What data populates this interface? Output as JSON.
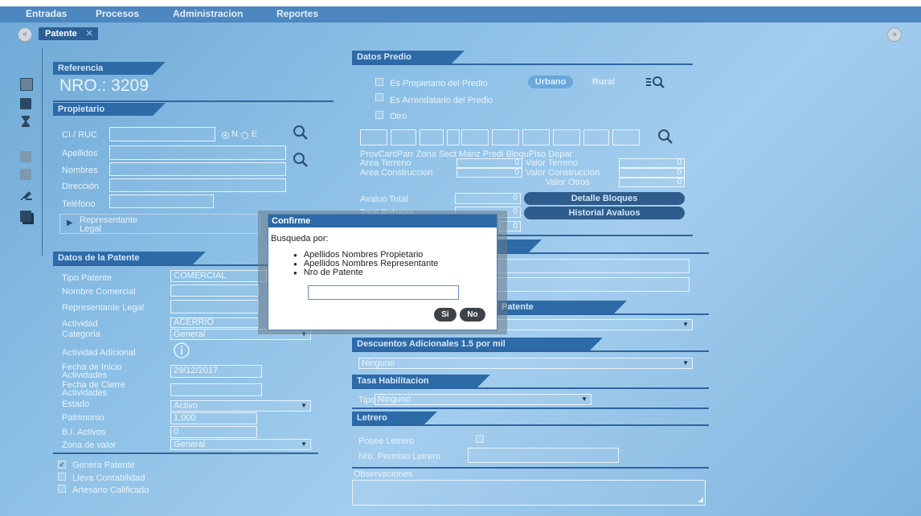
{
  "menu": [
    "Entradas",
    "Procesos",
    "Administracion",
    "Reportes"
  ],
  "tab": {
    "label": "Patente",
    "close": "✕"
  },
  "nav": {
    "prev": "«",
    "next": "»"
  },
  "referencia": {
    "header": "Referencia",
    "nro": "NRO.: 3209"
  },
  "propietario": {
    "header": "Propietario",
    "ci_label": "CI / RUC",
    "ci_value": "",
    "radio_n": "N",
    "radio_e": "E",
    "apellidos_label": "Apellidos",
    "nombres_label": "Nombres",
    "direccion_label": "Dirección",
    "telefono_label": "Teléfono",
    "representante_label_1": "Representante",
    "representante_label_2": "Legal"
  },
  "datos_predio": {
    "header": "Datos Predio",
    "es_propietario": "Es Propietario del Predio",
    "es_arrendatario": "Es Arrendatario del Predio",
    "otro": "Otro",
    "urbano": "Urbano",
    "rural": "Rural",
    "col_labels": "ProvCantParr Zona Sect  Manz Predi BloquPiso  Depar",
    "area_terreno_label": "Area Terreno",
    "area_terreno_value": "0",
    "area_construccion_label": "Area Construccion",
    "area_construccion_value": "0",
    "valor_terreno_label": "Valor Terreno",
    "valor_terreno_value": "0",
    "valor_construccion_label": "Valor Construccion",
    "valor_construccion_value": "0",
    "valor_otros_label": "Valor Otros",
    "valor_otros_value": "0",
    "avaluo_total_label": "Avaluo Total",
    "avaluo_total_value": "0",
    "total_rebajas_label": "Total Rebajas",
    "total_rebajas_value": "0",
    "extra_value": "0",
    "detalle_bloques": "Detalle Bloques",
    "historial_avaluos": "Historial Avaluos"
  },
  "datos_patente": {
    "header": "Datos de la Patente",
    "tipo_label": "Tipo Patente",
    "tipo_value": "COMERCIAL",
    "nombre_comercial_label": "Nombre Comercial",
    "representante_legal_label": "Representante Legal",
    "actividad_label": "Actividad",
    "actividad_value": "ACERRIO",
    "categoria_label": "Categoria",
    "categoria_value": "General",
    "actividad_adicional_label": "Actividad Adicional",
    "fecha_inicio_label_1": "Fecha de Inicio",
    "fecha_inicio_label_2": "Actividades",
    "fecha_inicio_value": "29/12/2017",
    "fecha_cierre_label_1": "Fecha de Cierre",
    "fecha_cierre_label_2": "Actividades",
    "estado_label": "Estado",
    "estado_value": "Activo",
    "patrimonio_label": "Patrimonio",
    "patrimonio_value": "1,000",
    "bi_activos_label": "B.I. Activos",
    "bi_activos_value": "0",
    "zona_valor_label": "Zona de valor",
    "zona_valor_value": "General",
    "genera_patente": "Genera Patente",
    "lleva_contabilidad": "Lleva Contabilidad",
    "artesano_calificado": "Artesano Calificado"
  },
  "right_sections": {
    "patente_partial": "Patente",
    "descuentos_header": "Descuentos Adicionales 1.5 por mil",
    "descuentos_value": "Ninguno",
    "tasa_header": "Tasa Habilitacion",
    "tipo_label": "Tipo",
    "tipo_value": "Ninguno",
    "letrero_header": "Letrero",
    "posee_letrero": "Posee Letrero",
    "nro_permiso_label": "Nro. Permiso Letrero",
    "observaciones_label": "Observaciones"
  },
  "dialog": {
    "title": "Confirme",
    "prompt": "Busqueda por:",
    "options": [
      "Apellidos Nombres Propietario",
      "Apellidos Nombres Representante",
      "Nro de Patente"
    ],
    "input_value": "",
    "si": "Si",
    "no": "No"
  }
}
